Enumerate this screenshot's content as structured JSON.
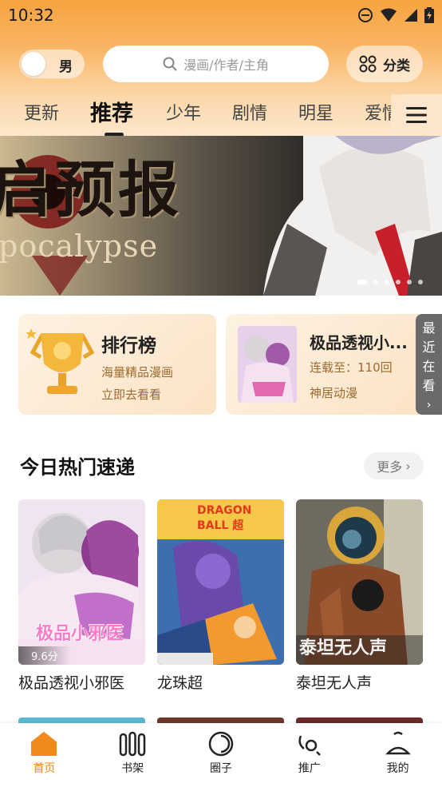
{
  "status_bar": {
    "time": "10:32"
  },
  "topbar": {
    "gender_label": "男",
    "search_placeholder": "漫画/作者/主角",
    "category_label": "分类"
  },
  "tabs": [
    {
      "label": "更新"
    },
    {
      "label": "推荐"
    },
    {
      "label": "少年"
    },
    {
      "label": "剧情"
    },
    {
      "label": "明星"
    },
    {
      "label": "爱情"
    }
  ],
  "active_tab_index": 1,
  "banner": {
    "title_text": "启预报",
    "subtitle_text": "pocalypse",
    "slides_count": 6,
    "active_slide": 1
  },
  "rank_card": {
    "title": "排行榜",
    "line1": "海量精品漫画",
    "line2": "立即去看看"
  },
  "featured_book": {
    "title": "极品透视小...",
    "progress": "连载至：110回",
    "publisher": "神居动漫"
  },
  "recent_tab": {
    "label_chars": [
      "最",
      "近",
      "在",
      "看"
    ]
  },
  "section": {
    "title": "今日热门速递",
    "more_label": "更多"
  },
  "comics": [
    {
      "title": "极品透视小邪医",
      "rating": "9.6分",
      "cover_text": "极品小邪医"
    },
    {
      "title": "龙珠超",
      "rating": "",
      "cover_text": "DRAGON BALL 超"
    },
    {
      "title": "泰坦无人声",
      "rating": "",
      "cover_text": "泰坦无人声"
    }
  ],
  "bottom_nav": [
    {
      "label": "首页",
      "icon": "home-icon",
      "active": true
    },
    {
      "label": "书架",
      "icon": "bookshelf-icon",
      "active": false
    },
    {
      "label": "圈子",
      "icon": "circle-icon",
      "active": false
    },
    {
      "label": "推广",
      "icon": "promote-icon",
      "active": false
    },
    {
      "label": "我的",
      "icon": "profile-icon",
      "active": false
    }
  ],
  "colors": {
    "accent": "#f08a1c",
    "header_top": "#f7a33e",
    "card_bg": "#fce3c4"
  }
}
